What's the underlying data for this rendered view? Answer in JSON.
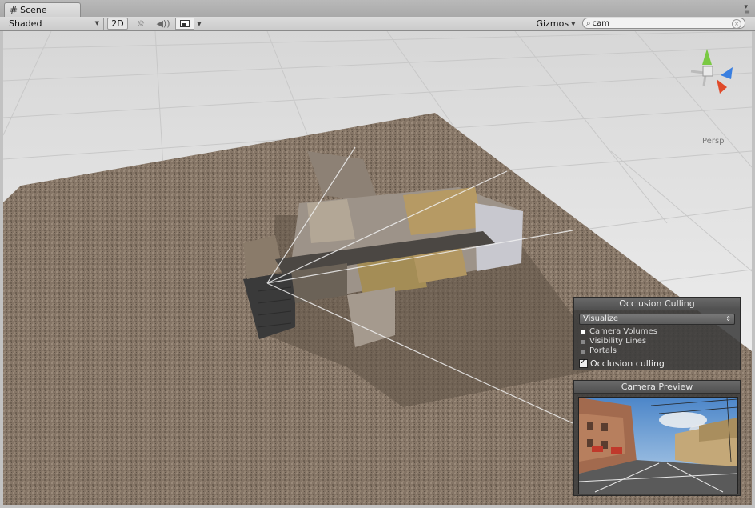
{
  "tab": {
    "icon": "scene-grid-icon",
    "label": "Scene"
  },
  "toolbar": {
    "draw_mode": "Shaded",
    "btn_2d": "2D",
    "light_glyph": "☼",
    "audio_glyph": "◀))",
    "gizmos_label": "Gizmos",
    "search_value": "cam"
  },
  "viewport": {
    "projection_label": "Persp"
  },
  "occlusion_panel": {
    "title": "Occlusion Culling",
    "mode": "Visualize",
    "options": [
      "Camera Volumes",
      "Visibility Lines",
      "Portals"
    ],
    "checkbox_label": "Occlusion culling",
    "checkbox_checked": true
  },
  "camera_preview": {
    "title": "Camera Preview"
  },
  "colors": {
    "ground": "#857566",
    "grid_floor": "#efefef",
    "panel_bg": "#3c3c3c",
    "axis_y": "#7ac943",
    "axis_x": "#e04a2a",
    "axis_z": "#3a7fe0"
  }
}
